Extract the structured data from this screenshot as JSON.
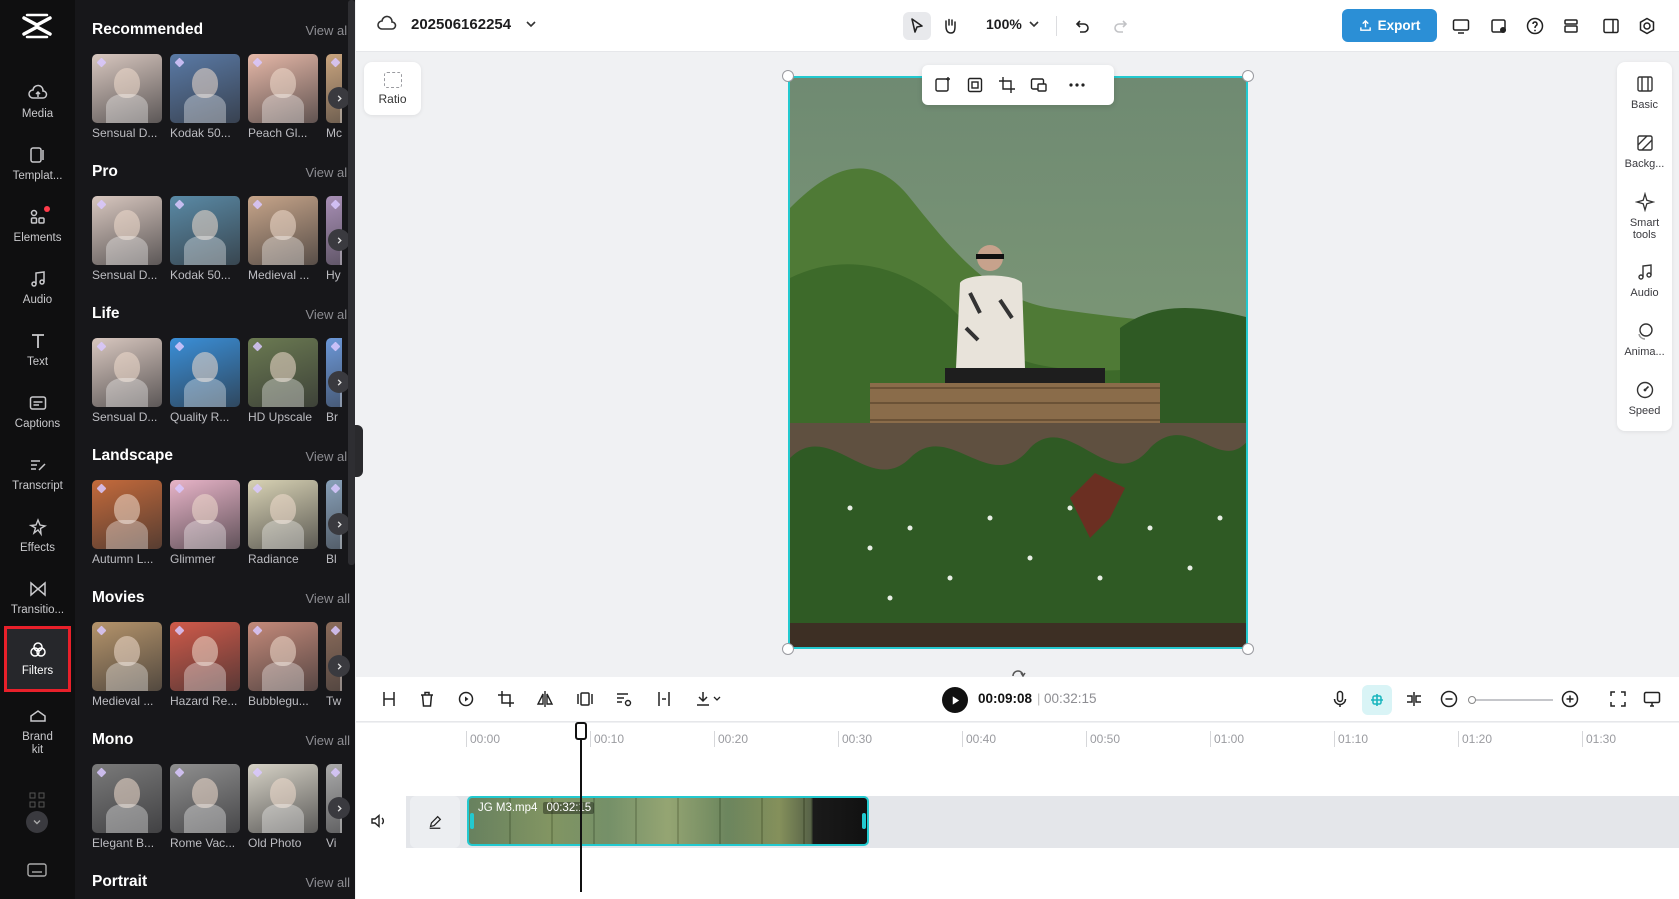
{
  "rail": {
    "items": [
      {
        "label": "Media",
        "icon": "cloud-upload-icon"
      },
      {
        "label": "Templat...",
        "icon": "template-icon"
      },
      {
        "label": "Elements",
        "icon": "shapes-icon"
      },
      {
        "label": "Audio",
        "icon": "music-note-icon"
      },
      {
        "label": "Text",
        "icon": "text-icon"
      },
      {
        "label": "Captions",
        "icon": "captions-icon"
      },
      {
        "label": "Transcript",
        "icon": "transcript-icon"
      },
      {
        "label": "Effects",
        "icon": "sparkle-icon"
      },
      {
        "label": "Transitio...",
        "icon": "bowtie-icon"
      },
      {
        "label": "Filters",
        "icon": "filters-icon"
      },
      {
        "label": "Brand kit",
        "icon": "briefcase-icon"
      }
    ],
    "active": "Filters"
  },
  "panel": {
    "view_all": "View all",
    "sections": [
      {
        "title": "Recommended",
        "items": [
          "Sensual D...",
          "Kodak 50...",
          "Peach Gl...",
          "Mc"
        ]
      },
      {
        "title": "Pro",
        "items": [
          "Sensual D...",
          "Kodak 50...",
          "Medieval ...",
          "Hy"
        ]
      },
      {
        "title": "Life",
        "items": [
          "Sensual D...",
          "Quality R...",
          "HD Upscale",
          "Br"
        ]
      },
      {
        "title": "Landscape",
        "items": [
          "Autumn L...",
          "Glimmer",
          "Radiance",
          "Bl"
        ]
      },
      {
        "title": "Movies",
        "items": [
          "Medieval ...",
          "Hazard Re...",
          "Bubblegu...",
          "Tw"
        ]
      },
      {
        "title": "Mono",
        "items": [
          "Elegant B...",
          "Rome Vac...",
          "Old Photo",
          "Vi"
        ]
      },
      {
        "title": "Portrait",
        "items": []
      }
    ]
  },
  "topbar": {
    "project_name": "202506162254",
    "zoom": "100%",
    "export_label": "Export"
  },
  "canvas": {
    "ratio_label": "Ratio"
  },
  "properties": {
    "items": [
      "Basic",
      "Backg...",
      "Smart tools",
      "Audio",
      "Anima...",
      "Speed"
    ]
  },
  "timeline": {
    "current_time": "00:09:08",
    "total_time": "00:32:15",
    "ticks": [
      "00:00",
      "00:10",
      "00:20",
      "00:30",
      "00:40",
      "00:50",
      "01:00",
      "01:10",
      "01:20",
      "01:30"
    ],
    "clip_name": "JG M3.mp4",
    "clip_duration": "00:32:15"
  },
  "colors": {
    "accent": "#23c9cf",
    "export": "#2b8fd6",
    "active_outline": "#e8202a"
  }
}
